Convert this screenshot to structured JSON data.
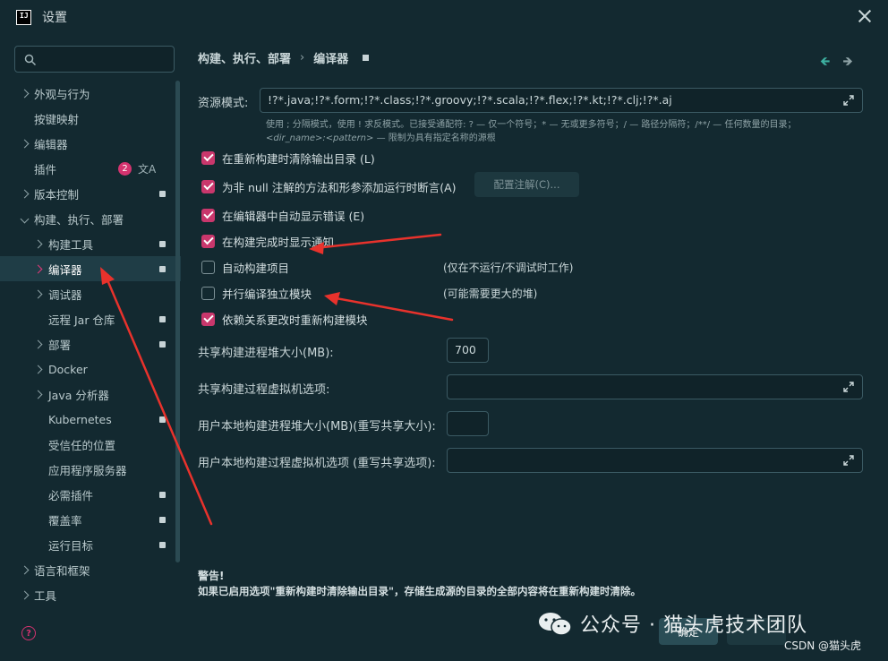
{
  "window": {
    "title": "设置",
    "logo_text": "IJ"
  },
  "search": {
    "placeholder": ""
  },
  "sidebar": {
    "items": [
      {
        "label": "外观与行为"
      },
      {
        "label": "按键映射"
      },
      {
        "label": "编辑器"
      },
      {
        "label": "插件",
        "badge": "2",
        "extra_icon": "translate-icon"
      },
      {
        "label": "版本控制"
      },
      {
        "label": "构建、执行、部署"
      },
      {
        "label": "构建工具"
      },
      {
        "label": "编译器"
      },
      {
        "label": "调试器"
      },
      {
        "label": "远程 Jar 仓库"
      },
      {
        "label": "部署"
      },
      {
        "label": "Docker"
      },
      {
        "label": "Java 分析器"
      },
      {
        "label": "Kubernetes"
      },
      {
        "label": "受信任的位置"
      },
      {
        "label": "应用程序服务器"
      },
      {
        "label": "必需插件"
      },
      {
        "label": "覆盖率"
      },
      {
        "label": "运行目标"
      },
      {
        "label": "语言和框架"
      },
      {
        "label": "工具"
      }
    ]
  },
  "breadcrumb": {
    "part1": "构建、执行、部署",
    "separator": "›",
    "part2": "编译器"
  },
  "resource_patterns": {
    "label": "资源模式:",
    "value": "!?*.java;!?*.form;!?*.class;!?*.groovy;!?*.scala;!?*.flex;!?*.kt;!?*.clj;!?*.aj",
    "hint_line1": "使用 ; 分隔模式，使用 ! 求反模式。已接受通配符: ? — 仅一个符号；* — 无或更多符号；/ — 路径分隔符；/**/ — 任何数量的目录；",
    "hint_line2_italic": "<dir_name>:<pattern>",
    "hint_line2_rest": " — 限制为具有指定名称的源根"
  },
  "options": [
    {
      "label": "在重新构建时清除输出目录 (L)",
      "checked": true
    },
    {
      "label": "为非 null 注解的方法和形参添加运行时断言(A)",
      "checked": true
    },
    {
      "label": "在编辑器中自动显示错误 (E)",
      "checked": true
    },
    {
      "label": "在构建完成时显示通知",
      "checked": true
    },
    {
      "label": "自动构建项目",
      "checked": false,
      "note": "(仅在不运行/不调试时工作)"
    },
    {
      "label": "并行编译独立模块",
      "checked": false,
      "note": "(可能需要更大的堆)"
    },
    {
      "label": "依赖关系更改时重新构建模块",
      "checked": true
    }
  ],
  "configure_annotations_button": "配置注解(C)...",
  "heap_size": {
    "label": "共享构建进程堆大小(MB):",
    "value": "700"
  },
  "vm_options": {
    "label": "共享构建过程虚拟机选项:",
    "value": ""
  },
  "user_heap": {
    "label": "用户本地构建进程堆大小(MB)(重写共享大小):",
    "value": ""
  },
  "user_vm": {
    "label": "用户本地构建过程虚拟机选项 (重写共享选项):",
    "value": ""
  },
  "warning": {
    "title": "警告!",
    "text": "如果已启用选项\"重新构建时清除输出目录\"，存储生成源的目录的全部内容将在重新构建时清除。"
  },
  "buttons": {
    "ok": "确定",
    "cancel": ""
  },
  "watermark": {
    "text": "公众号 · 猫头虎技术团队",
    "csdn": "CSDN @猫头虎"
  },
  "colors": {
    "background": "#132930",
    "accent": "#c9376c",
    "arrow": "#e8322c"
  }
}
